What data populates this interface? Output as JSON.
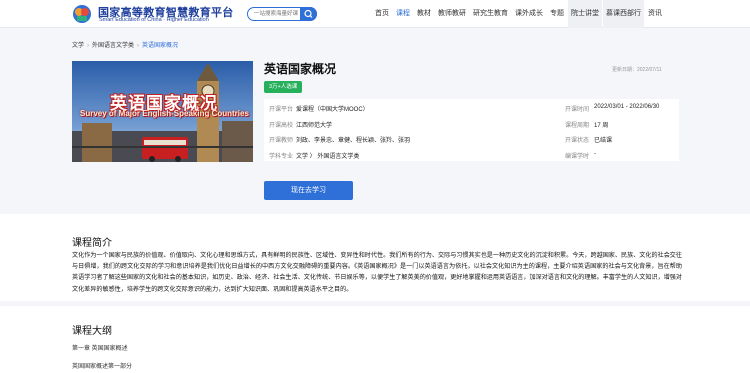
{
  "header": {
    "logo_cn": "国家高等教育智慧教育平台",
    "logo_en": "Smart Education of China · Higher Education",
    "search_placeholder": "一站搜索海量好课",
    "nav": [
      "首页",
      "课程",
      "教材",
      "教师教研",
      "研究生教育",
      "课外成长",
      "专题",
      "院士讲堂",
      "慕课西部行",
      "资讯"
    ],
    "active_nav": "课程"
  },
  "breadcrumb": [
    "文学",
    "外国语言文学类",
    "英语国家概况"
  ],
  "course": {
    "cover_title": "英语国家概况",
    "cover_subtitle": "Survey of Major English-Speaking Countries",
    "title": "英语国家概况",
    "update": "更新日期：2022/07/11",
    "badge": "3万+人选课",
    "info": {
      "platform_label": "开课平台",
      "platform": "爱课程（中国大学MOOC）",
      "start_label": "开课时间",
      "start": "2022/03/01 - 2022/06/30",
      "school_label": "开课高校",
      "school": "江西师范大学",
      "weeks_label": "课程周期",
      "weeks": "17 周",
      "teachers_label": "开课教师",
      "teachers": "刘政、李景忠、章健、程长颖、张羚、张羽",
      "status_label": "开课状态",
      "status": "已结课",
      "subject_label": "学科专业",
      "subject": "文学 〉 外国语言文学类",
      "apply_label": "编课学时",
      "apply": "-"
    },
    "study_btn": "现在去学习"
  },
  "intro": {
    "title": "课程简介",
    "text": "文化作为一个国家与民族的价值观、价值取向、文化心理和思维方式，具有鲜明的民族性、区域性、变异性和时代性。我们所有的行为、交际与习惯其实也是一种历史文化的沉淀和积累。今天，跨越国家、民族、文化的社会交往与日俱增，我们的跨文化交际的学习和意识培养是我们优化日益增长的中西方文化交融障碍的重要内容。《英语国家概况》是一门以英语语言为依托，以社会文化知识为主的课程，主要介绍英语国家的社会与文化背景，旨在帮助英语学习者了解这些国家的文化和社会的基本知识，如历史、政治、经济、社会生活、文化传统、节日娱乐等，以便学生了解英美的价值观，更好地掌握和运用英语语言，加深对语言和文化的理解。丰富学生的人文知识，增强对文化差异的敏感性，培养学生的跨文化交际意识的能力，达到扩大知识面、巩固和提高英语水平之目的。"
  },
  "outline": {
    "title": "课程大纲",
    "chapters": [
      "第一章 英国国家概述",
      "英国国家概述第一部分"
    ]
  }
}
